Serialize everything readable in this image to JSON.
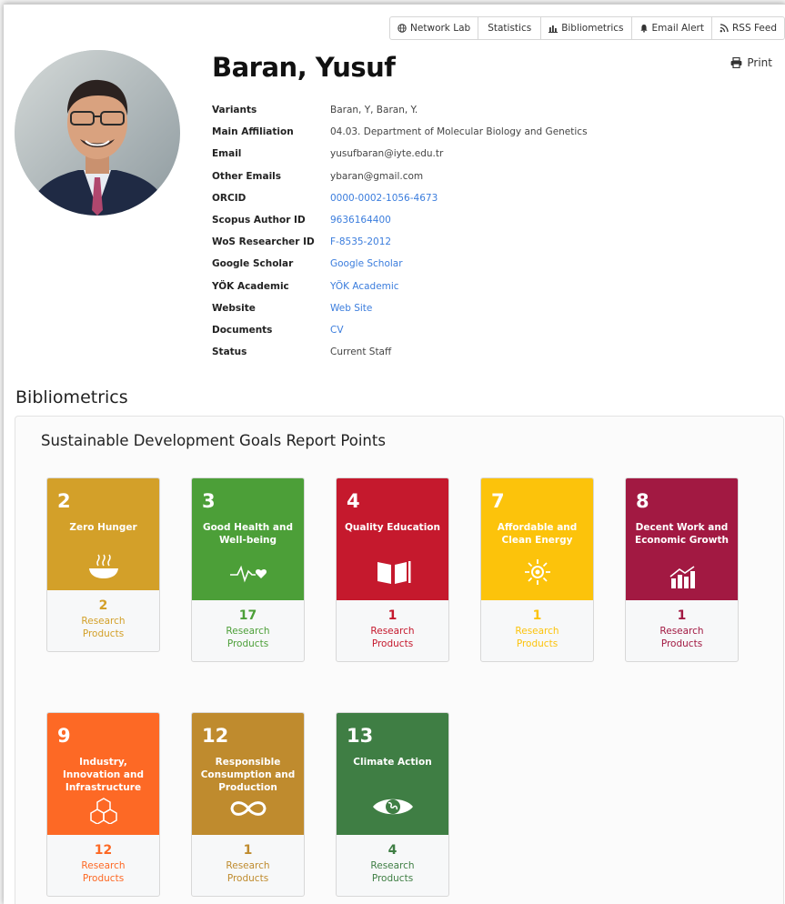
{
  "toolbar": {
    "network_lab": "Network Lab",
    "statistics": "Statistics",
    "bibliometrics": "Bibliometrics",
    "email_alert": "Email Alert",
    "rss_feed": "RSS Feed"
  },
  "profile": {
    "name": "Baran, Yusuf",
    "print": "Print",
    "fields": [
      {
        "label": "Variants",
        "value": "Baran, Y, Baran, Y."
      },
      {
        "label": "Main Affiliation",
        "value": "04.03. Department of Molecular Biology and Genetics"
      },
      {
        "label": "Email",
        "value": "yusufbaran@iyte.edu.tr"
      },
      {
        "label": "Other Emails",
        "value": "ybaran@gmail.com"
      },
      {
        "label": "ORCID",
        "value": "0000-0002-1056-4673"
      },
      {
        "label": "Scopus Author ID",
        "value": "9636164400"
      },
      {
        "label": "WoS Researcher ID",
        "value": "F-8535-2012"
      },
      {
        "label": "Google Scholar",
        "value": "Google Scholar"
      },
      {
        "label": "YÖK Academic",
        "value": "YÖK Academic"
      },
      {
        "label": "Website",
        "value": "Web Site"
      },
      {
        "label": "Documents",
        "value": "CV"
      },
      {
        "label": "Status",
        "value": "Current Staff"
      }
    ]
  },
  "bibliometrics": {
    "section_title": "Bibliometrics",
    "panel_title": "Sustainable Development Goals Report Points",
    "research_label_line1": "Research",
    "research_label_line2": "Products",
    "goals": [
      {
        "num": "2",
        "title": "Zero Hunger",
        "count": "2",
        "color": "#d3a029",
        "text_color": "#d3a029",
        "icon": "bowl-icon"
      },
      {
        "num": "3",
        "title": "Good Health and Well-being",
        "count": "17",
        "color": "#4c9f38",
        "text_color": "#4c9f38",
        "icon": "heartbeat-icon"
      },
      {
        "num": "4",
        "title": "Quality Education",
        "count": "1",
        "color": "#c5192d",
        "text_color": "#c5192d",
        "icon": "book-icon"
      },
      {
        "num": "7",
        "title": "Affordable and Clean Energy",
        "count": "1",
        "color": "#fcc30b",
        "text_color": "#fcc30b",
        "icon": "sun-icon"
      },
      {
        "num": "8",
        "title": "Decent Work and Economic Growth",
        "count": "1",
        "color": "#a21942",
        "text_color": "#a21942",
        "icon": "growth-chart-icon"
      },
      {
        "num": "9",
        "title": "Industry, Innovation and Infrastructure",
        "count": "12",
        "color": "#fd6925",
        "text_color": "#fd6925",
        "icon": "cubes-icon"
      },
      {
        "num": "12",
        "title": "Responsible Consumption and Production",
        "count": "1",
        "color": "#bf8b2e",
        "text_color": "#bf8b2e",
        "icon": "infinity-icon"
      },
      {
        "num": "13",
        "title": "Climate Action",
        "count": "4",
        "color": "#3f7e44",
        "text_color": "#3f7e44",
        "icon": "eye-globe-icon"
      }
    ]
  }
}
